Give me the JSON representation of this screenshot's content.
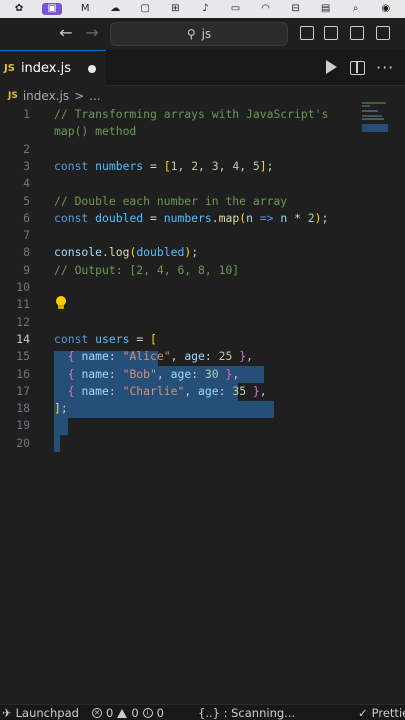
{
  "titlebar": {
    "search_text": "js"
  },
  "tab": {
    "badge": "JS",
    "filename": "index.js"
  },
  "breadcrumb": {
    "badge": "JS",
    "file": "index.js",
    "separator": ">",
    "more": "..."
  },
  "editor": {
    "lines": [
      {
        "n": "1",
        "html": "<span class='c-com'>// Transforming arrays with JavaScript's</span>"
      },
      {
        "n": "",
        "html": "<span class='c-com'>map() method</span>"
      },
      {
        "n": "2",
        "html": ""
      },
      {
        "n": "3",
        "html": "<span class='c-kw'>const</span> <span class='c-const'>numbers</span> <span class='c-op'>=</span> <span class='c-br'>[</span><span class='c-num'>1</span>, <span class='c-num'>2</span>, <span class='c-num'>3</span>, <span class='c-num'>4</span>, <span class='c-num'>5</span><span class='c-br'>]</span>;"
      },
      {
        "n": "4",
        "html": ""
      },
      {
        "n": "5",
        "html": "<span class='c-com'>// Double each number in the array</span>"
      },
      {
        "n": "6",
        "html": "<span class='c-kw'>const</span> <span class='c-const'>doubled</span> <span class='c-op'>=</span> <span class='c-const'>numbers</span>.<span class='c-fn'>map</span><span class='c-br'>(</span><span class='c-var'>n</span> <span class='c-kw'>=&gt;</span> <span class='c-var'>n</span> <span class='c-op'>*</span> <span class='c-num'>2</span><span class='c-br'>)</span>;"
      },
      {
        "n": "7",
        "html": ""
      },
      {
        "n": "8",
        "html": "<span class='c-var'>console</span>.<span class='c-fn'>log</span><span class='c-br'>(</span><span class='c-const'>doubled</span><span class='c-br'>)</span>;"
      },
      {
        "n": "9",
        "html": "<span class='c-com'>// Output: [2, 4, 6, 8, 10]</span>"
      },
      {
        "n": "10",
        "html": ""
      },
      {
        "n": "11",
        "html": ""
      },
      {
        "n": "12",
        "html": ""
      },
      {
        "n": "14",
        "html": "<span class='c-kw'>const</span> <span class='c-const'>users</span> <span class='c-op'>=</span> <span class='c-br'>[</span>",
        "current": true
      },
      {
        "n": "15",
        "html": "  <span class='c-br2'>{</span> <span class='c-var'>name</span>: <span class='c-str'>\"Alice\"</span>, <span class='c-var'>age</span>: <span class='c-num'>25</span> <span class='c-br2'>}</span>,"
      },
      {
        "n": "16",
        "html": "  <span class='c-br2'>{</span> <span class='c-var'>name</span>: <span class='c-str'>\"Bob\"</span>, <span class='c-var'>age</span>: <span class='c-num'>30</span> <span class='c-br2'>}</span>,"
      },
      {
        "n": "17",
        "html": "  <span class='c-br2'>{</span> <span class='c-var'>name</span>: <span class='c-str'>\"Charlie\"</span>, <span class='c-var'>age</span>: <span class='c-num'>35</span> <span class='c-br2'>}</span>,"
      },
      {
        "n": "18",
        "html": "<span class='c-br'>]</span>;"
      },
      {
        "n": "19",
        "html": ""
      },
      {
        "n": "20",
        "html": ""
      }
    ]
  },
  "statusbar": {
    "launchpad": "Launchpad",
    "errors": "0",
    "warnings": "0",
    "info": "0",
    "scanning": "{..} : Scanning...",
    "prettier": "Prettier"
  }
}
